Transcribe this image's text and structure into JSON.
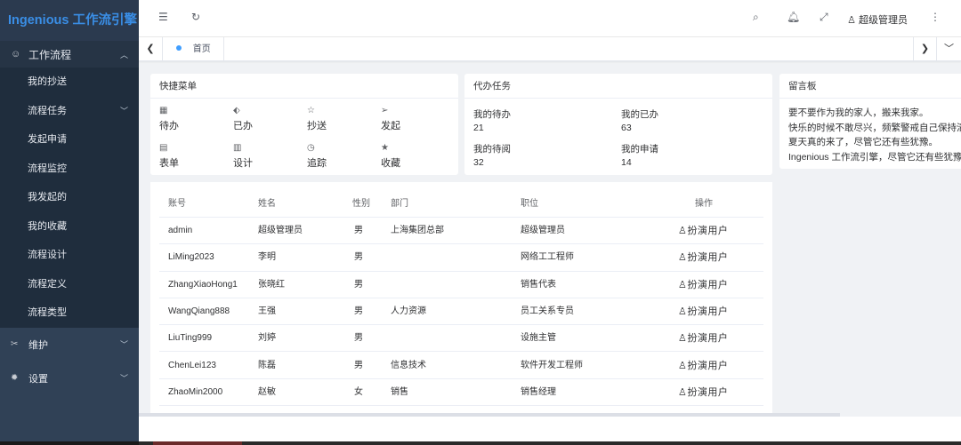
{
  "app": {
    "title": "Ingenious 工作流引擎"
  },
  "sidebar": {
    "group_open": {
      "icon": "smile-icon",
      "label": "工作流程"
    },
    "items": [
      {
        "label": "我的抄送"
      },
      {
        "label": "流程任务"
      },
      {
        "label": "发起申请"
      },
      {
        "label": "流程监控"
      },
      {
        "label": "我发起的"
      },
      {
        "label": "我的收藏"
      },
      {
        "label": "流程设计"
      },
      {
        "label": "流程定义"
      },
      {
        "label": "流程类型"
      }
    ],
    "maintain": {
      "icon": "scissors-icon",
      "label": "维护"
    },
    "settings": {
      "icon": "gear-icon",
      "label": "设置"
    }
  },
  "header": {
    "user_name": "超级管理员"
  },
  "tags": {
    "active": "首页"
  },
  "quick_menu": {
    "title": "快捷菜单",
    "items": [
      {
        "label": "待办",
        "icon": "grid-icon"
      },
      {
        "label": "已办",
        "icon": "tag-icon"
      },
      {
        "label": "抄送",
        "icon": "star-outline-icon"
      },
      {
        "label": "发起",
        "icon": "send-icon"
      },
      {
        "label": "表单",
        "icon": "form-icon"
      },
      {
        "label": "设计",
        "icon": "design-icon"
      },
      {
        "label": "追踪",
        "icon": "clock-icon"
      },
      {
        "label": "收藏",
        "icon": "star-filled-icon"
      }
    ]
  },
  "todo": {
    "title": "代办任务",
    "stats": [
      {
        "label": "我的待办",
        "value": "21"
      },
      {
        "label": "我的已办",
        "value": "63"
      },
      {
        "label": "我的待阅",
        "value": "32"
      },
      {
        "label": "我的申请",
        "value": "14"
      }
    ]
  },
  "board": {
    "title": "留言板",
    "lines": [
      "要不要作为我的家人，搬来我家。",
      "快乐的时候不敢尽兴，频繁警戒自己保持清醒。",
      "夏天真的来了，尽管它还有些犹豫。",
      "Ingenious 工作流引擎，尽管它还有些犹豫。"
    ]
  },
  "table": {
    "headers": [
      "账号",
      "姓名",
      "性别",
      "部门",
      "职位",
      "操作"
    ],
    "action_label": "扮演用户",
    "rows": [
      {
        "account": "admin",
        "name": "超级管理员",
        "gender": "男",
        "dept": "上海集团总部",
        "position": "超级管理员"
      },
      {
        "account": "LiMing2023",
        "name": "李明",
        "gender": "男",
        "dept": "",
        "position": "网络工工程师"
      },
      {
        "account": "ZhangXiaoHong1",
        "name": "张晓红",
        "gender": "男",
        "dept": "",
        "position": "销售代表"
      },
      {
        "account": "WangQiang888",
        "name": "王强",
        "gender": "男",
        "dept": "人力资源",
        "position": "员工关系专员"
      },
      {
        "account": "LiuTing999",
        "name": "刘婷",
        "gender": "男",
        "dept": "",
        "position": "设施主管"
      },
      {
        "account": "ChenLei123",
        "name": "陈磊",
        "gender": "男",
        "dept": "信息技术",
        "position": "软件开发工程师"
      },
      {
        "account": "ZhaoMin2000",
        "name": "赵敏",
        "gender": "女",
        "dept": "销售",
        "position": "销售经理"
      }
    ]
  }
}
